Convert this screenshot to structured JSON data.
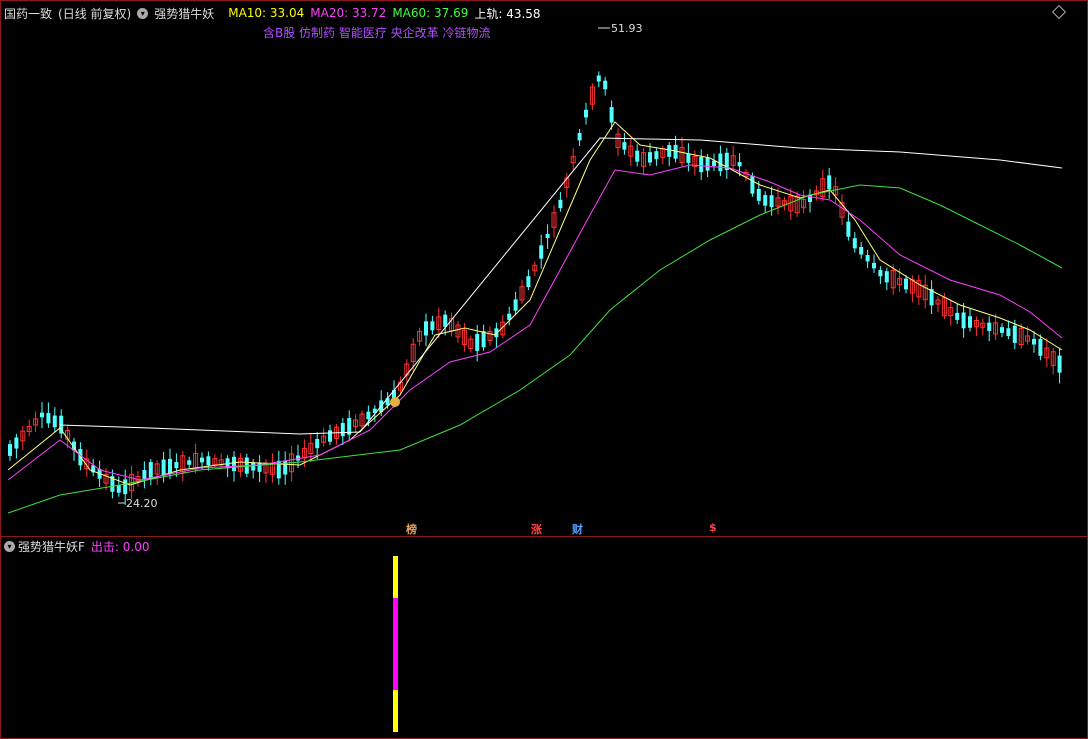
{
  "header": {
    "stock_name": "国药一致",
    "period": "(日线 前复权)",
    "indicator": "强势猎牛妖",
    "ma10": "MA10: 33.04",
    "ma20": "MA20: 33.72",
    "ma60": "MA60: 37.69",
    "upper": "上轨: 43.58"
  },
  "concepts": "含B股 仿制药 智能医疗 央企改革 冷链物流",
  "price_high_label": "51.93",
  "price_low_label": "24.20",
  "event_markers": [
    {
      "text": "榜",
      "color": "#e8a060"
    },
    {
      "text": "涨",
      "color": "#ff4040"
    },
    {
      "text": "财",
      "color": "#4fa0ff"
    },
    {
      "text": "$",
      "color": "#ff4040"
    }
  ],
  "sub_panel": {
    "indicator": "强势猎牛妖F",
    "value": "出击: 0.00"
  },
  "colors": {
    "up": "#ff3232",
    "down": "#54ffff",
    "ma10": "#ffff80",
    "ma20": "#ff40ff",
    "ma60": "#40e040",
    "upper": "#ffffff",
    "ma10_label": "#ffff00",
    "ma20_label": "#ff40ff",
    "ma60_label": "#40ff40"
  }
}
